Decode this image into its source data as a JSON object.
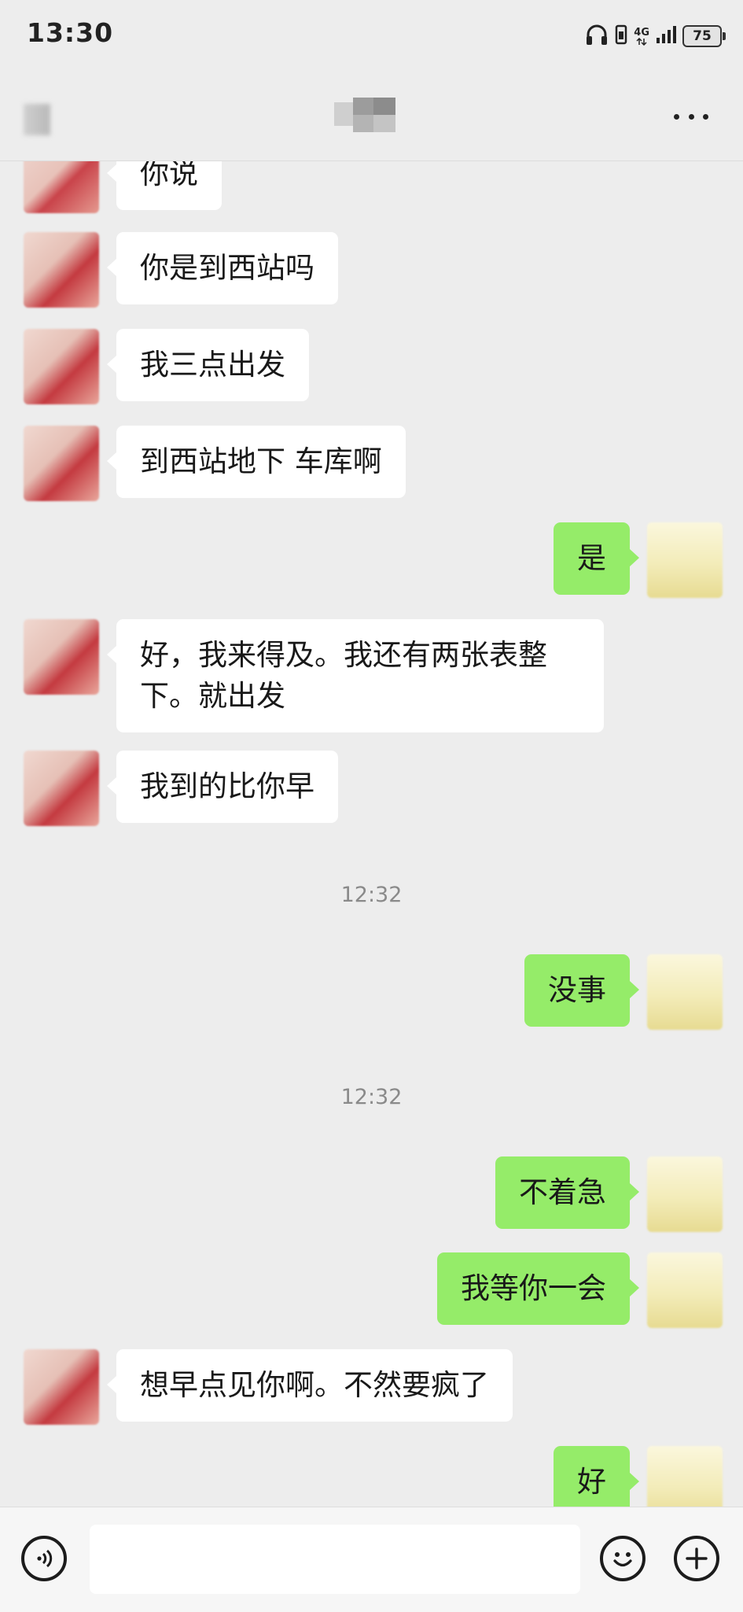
{
  "status_bar": {
    "time": "13:30",
    "network": "4G",
    "battery": "75",
    "icons": [
      "headphones-icon",
      "sim-icon",
      "signal-icon",
      "battery-icon"
    ]
  },
  "nav": {
    "icons": [
      "back-icon",
      "more-icon"
    ]
  },
  "chat": {
    "messages": [
      {
        "side": "left",
        "text": "你说"
      },
      {
        "side": "left",
        "text": "你是到西站吗"
      },
      {
        "side": "left",
        "text": "我三点出发"
      },
      {
        "side": "left",
        "text": "到西站地下 车库啊"
      },
      {
        "side": "right",
        "text": "是"
      },
      {
        "side": "left",
        "text": "好，我来得及。我还有两张表整下。就出发"
      },
      {
        "side": "left",
        "text": "我到的比你早"
      },
      {
        "type": "time",
        "text": "12:32"
      },
      {
        "side": "right",
        "text": "没事"
      },
      {
        "type": "time",
        "text": "12:32"
      },
      {
        "side": "right",
        "text": "不着急"
      },
      {
        "side": "right",
        "text": "我等你一会"
      },
      {
        "side": "left",
        "text": "想早点见你啊。不然要疯了"
      },
      {
        "side": "right",
        "text": "好"
      }
    ]
  },
  "input_bar": {
    "value": "",
    "icons": [
      "voice-icon",
      "emoji-icon",
      "plus-icon"
    ]
  },
  "colors": {
    "background": "#ededed",
    "self_bubble": "#95ec69",
    "other_bubble": "#ffffff",
    "timestamp": "#8a8a8a"
  }
}
